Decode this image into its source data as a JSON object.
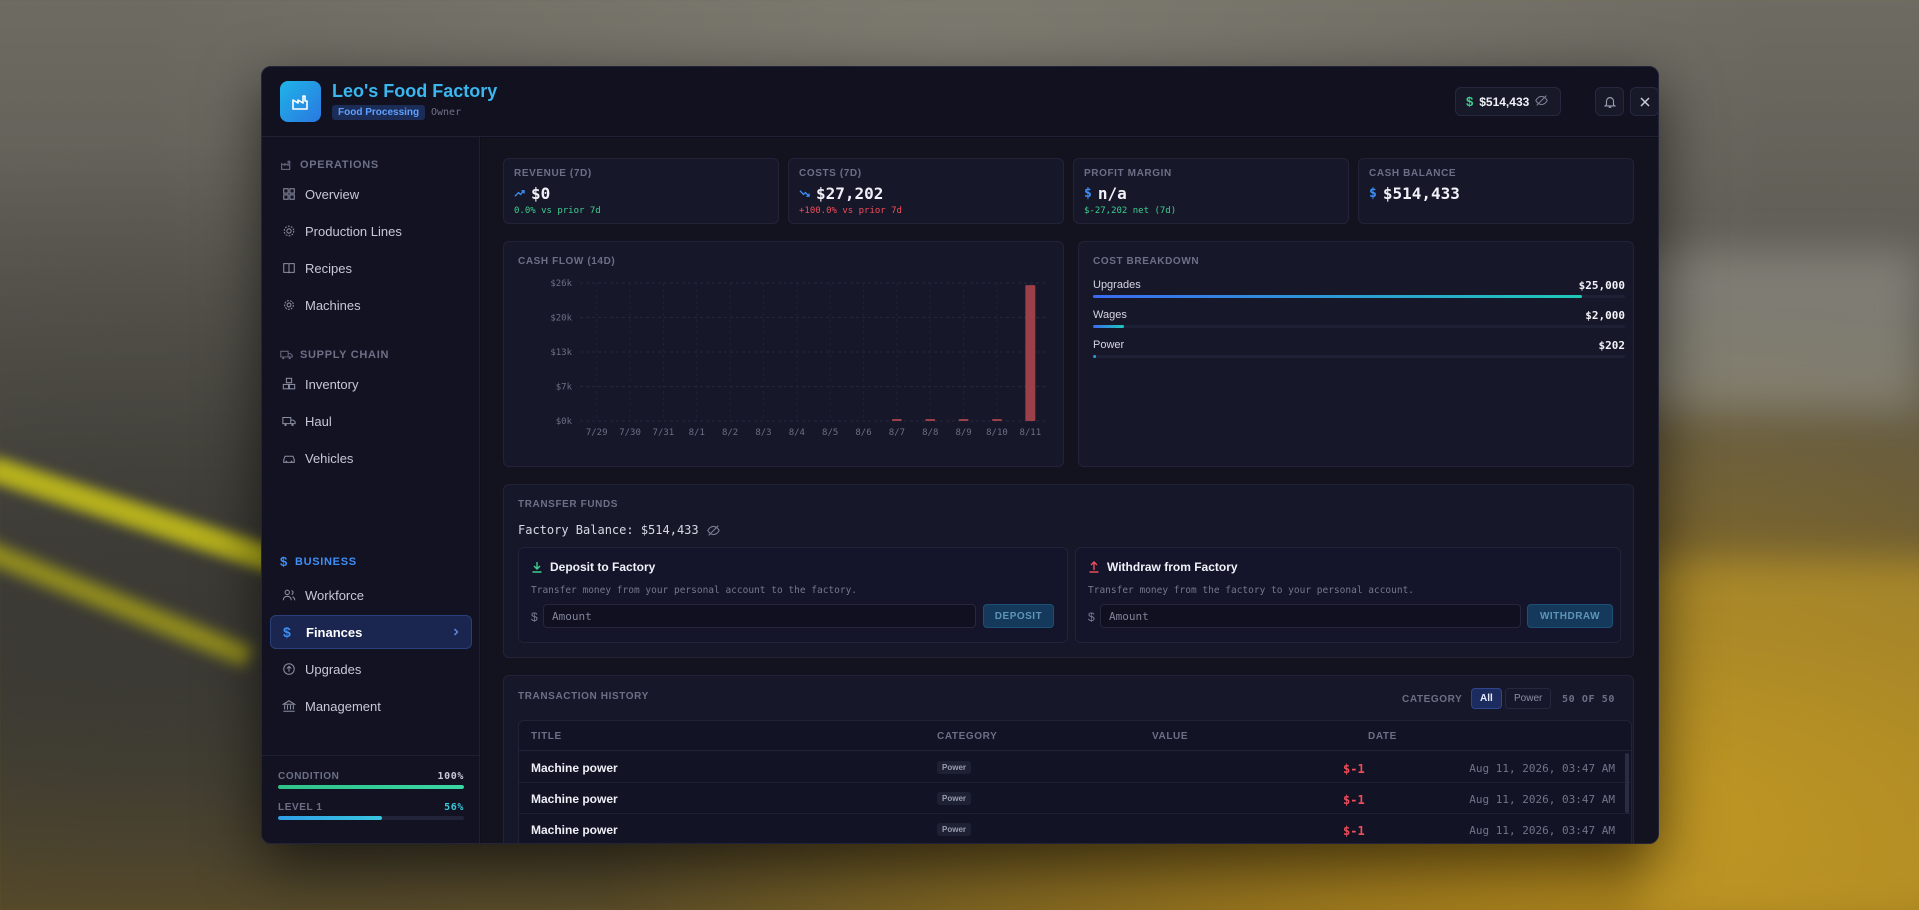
{
  "header": {
    "title": "Leo's Food Factory",
    "category_badge": "Food Processing",
    "role": "Owner",
    "balance": "$514,433"
  },
  "sidebar": {
    "sections": [
      {
        "label": "OPERATIONS",
        "items": [
          "Overview",
          "Production Lines",
          "Recipes",
          "Machines"
        ]
      },
      {
        "label": "SUPPLY CHAIN",
        "items": [
          "Inventory",
          "Haul",
          "Vehicles"
        ]
      },
      {
        "label": "BUSINESS",
        "items": [
          "Workforce",
          "Finances",
          "Upgrades",
          "Management"
        ]
      }
    ],
    "active_item": "Finances",
    "condition_label": "CONDITION",
    "condition_value": "100%",
    "condition_fraction": 1.0,
    "level_label": "LEVEL 1",
    "level_value": "56%",
    "level_fraction": 0.56
  },
  "kpis": [
    {
      "label": "REVENUE (7D)",
      "value": "$0",
      "sub": "0.0% vs prior 7d",
      "sub_color": "#3ccf8e"
    },
    {
      "label": "COSTS (7D)",
      "value": "$27,202",
      "sub": "+100.0% vs prior 7d",
      "sub_color": "#ef4e5a"
    },
    {
      "label": "PROFIT MARGIN",
      "value": "n/a",
      "sub": "$-27,202 net (7d)",
      "sub_color": "#3ccf8e"
    },
    {
      "label": "CASH BALANCE",
      "value": "$514,433",
      "sub": "",
      "sub_color": ""
    }
  ],
  "cashflow": {
    "label": "CASH FLOW (14D)"
  },
  "chart_data": {
    "type": "bar",
    "categories": [
      "7/29",
      "7/30",
      "7/31",
      "8/1",
      "8/2",
      "8/3",
      "8/4",
      "8/5",
      "8/6",
      "8/7",
      "8/8",
      "8/9",
      "8/10",
      "8/11"
    ],
    "values": [
      0,
      0,
      0,
      0,
      0,
      0,
      0,
      0,
      0,
      200,
      200,
      200,
      200,
      25600
    ],
    "ytick_labels": [
      "$0k",
      "$7k",
      "$13k",
      "$20k",
      "$26k"
    ],
    "ylim": [
      0,
      26000
    ],
    "grid": true,
    "title": "",
    "xlabel": "",
    "ylabel": "",
    "bar_color": "#9b3f48"
  },
  "cost_breakdown": {
    "label": "COST BREAKDOWN",
    "rows": [
      {
        "name": "Upgrades",
        "amount": "$25,000",
        "fraction": 0.919
      },
      {
        "name": "Wages",
        "amount": "$2,000",
        "fraction": 0.058
      },
      {
        "name": "Power",
        "amount": "$202",
        "fraction": 0.006
      }
    ]
  },
  "transfer": {
    "label": "TRANSFER FUNDS",
    "factory_balance": "Factory Balance: $514,433",
    "deposit": {
      "title": "Deposit to Factory",
      "desc": "Transfer money from your personal account to the factory.",
      "currency": "$",
      "placeholder": "Amount",
      "button": "DEPOSIT"
    },
    "withdraw": {
      "title": "Withdraw from Factory",
      "desc": "Transfer money from the factory to your personal account.",
      "currency": "$",
      "placeholder": "Amount",
      "button": "WITHDRAW"
    }
  },
  "transactions": {
    "label": "TRANSACTION HISTORY",
    "category_label": "CATEGORY",
    "filters": [
      "All",
      "Power"
    ],
    "count": "50 OF 50",
    "columns": [
      "TITLE",
      "CATEGORY",
      "VALUE",
      "DATE"
    ],
    "rows": [
      {
        "title": "Machine power",
        "category": "Power",
        "value": "$-1",
        "date": "Aug 11, 2026, 03:47 AM"
      },
      {
        "title": "Machine power",
        "category": "Power",
        "value": "$-1",
        "date": "Aug 11, 2026, 03:47 AM"
      },
      {
        "title": "Machine power",
        "category": "Power",
        "value": "$-1",
        "date": "Aug 11, 2026, 03:47 AM"
      }
    ]
  },
  "colors": {
    "accent": "#3d8ef5",
    "positive": "#3ccf8e",
    "negative": "#ef4e5a"
  }
}
